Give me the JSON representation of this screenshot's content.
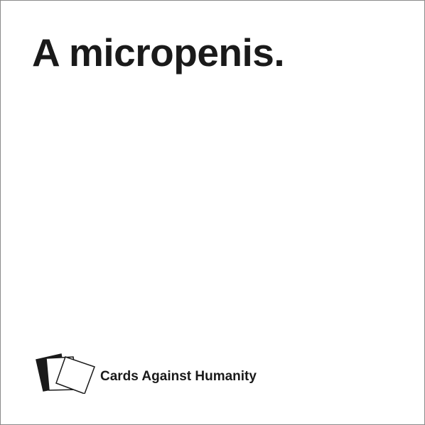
{
  "card": {
    "text": "A micropenis.",
    "brand_name": "Cards Against Humanity",
    "logo_icon": "stacked-cards-icon",
    "background_color": "#ffffff",
    "text_color": "#1a1a1a",
    "border_color": "#8a8a8a"
  }
}
